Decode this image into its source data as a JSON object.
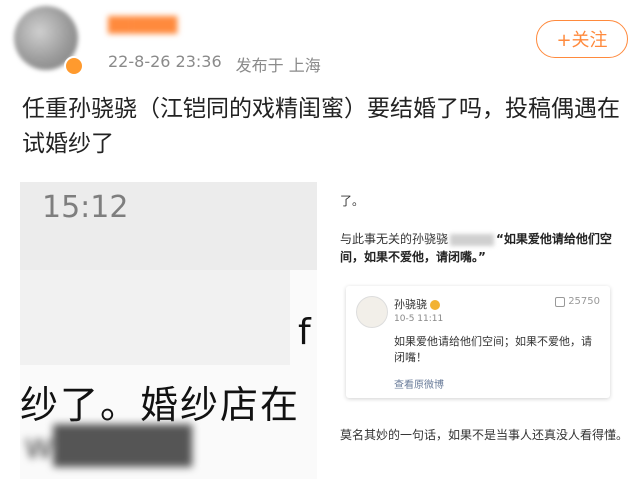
{
  "header": {
    "username": "██████",
    "timestamp": "22-8-26 23:36",
    "location": "发布于 上海",
    "follow_label": "+关注"
  },
  "post": {
    "text": "任重孙骁骁（江铠同的戏精闺蜜）要结婚了吗，投稿偶遇在试婚纱了"
  },
  "left_image": {
    "time": "15:12",
    "fragment": "f",
    "big_line": "纱了。婚纱店在",
    "blur_line": "w█████"
  },
  "right_image": {
    "line0": "了。",
    "line1_prefix": "与此事无关的孙骁骁",
    "line1_quote": "“如果爱他请给他们空间，如果不爱他，请闭嘴。”",
    "card": {
      "name": "孙骁骁",
      "time": "10-5 11:11",
      "likes": "25750",
      "body": "如果爱他请给他们空间；如果不爱他，请闭嘴！",
      "link": "查看原微博"
    },
    "bottom": "莫名其妙的一句话，如果不是当事人还真没人看得懂。"
  },
  "colors": {
    "accent": "#ff8a3d",
    "meta_grey": "#8a8a8a"
  }
}
